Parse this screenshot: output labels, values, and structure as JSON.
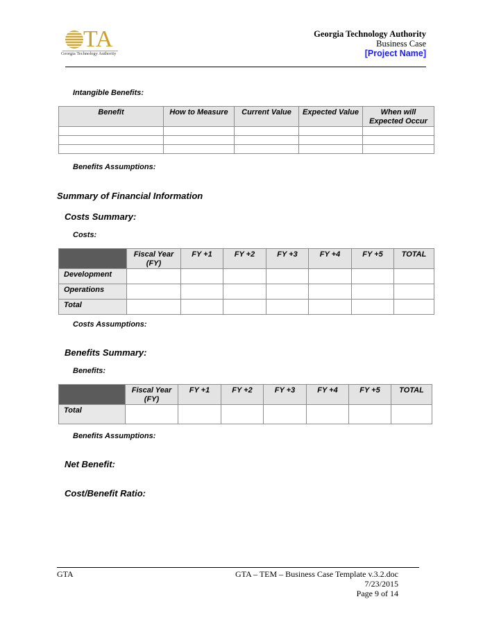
{
  "header": {
    "logo_text": "GTA",
    "logo_subtitle": "Georgia Technology Authority",
    "organization": "Georgia Technology Authority",
    "document_type": "Business Case",
    "project_name": "[Project Name]"
  },
  "intangible_benefits": {
    "label": "Intangible Benefits:",
    "columns": [
      "Benefit",
      "How to Measure",
      "Current Value",
      "Expected Value",
      "When will Expected Occur"
    ],
    "rows": [
      [
        "",
        "",
        "",
        "",
        ""
      ],
      [
        "",
        "",
        "",
        "",
        ""
      ],
      [
        "",
        "",
        "",
        "",
        ""
      ]
    ]
  },
  "benefits_assumptions_1": "Benefits Assumptions:",
  "summary_heading": "Summary of Financial Information",
  "costs_summary": {
    "heading": "Costs Summary:",
    "label": "Costs:",
    "columns": [
      "",
      "Fiscal Year (FY)",
      "FY +1",
      "FY +2",
      "FY +3",
      "FY +4",
      "FY +5",
      "TOTAL"
    ],
    "rows": [
      {
        "label": "Development",
        "values": [
          "",
          "",
          "",
          "",
          "",
          "",
          ""
        ]
      },
      {
        "label": "Operations",
        "values": [
          "",
          "",
          "",
          "",
          "",
          "",
          ""
        ]
      },
      {
        "label": "Total",
        "values": [
          "",
          "",
          "",
          "",
          "",
          "",
          ""
        ]
      }
    ],
    "assumptions": "Costs Assumptions:"
  },
  "benefits_summary": {
    "heading": "Benefits Summary:",
    "label": "Benefits:",
    "columns": [
      "",
      "Fiscal Year (FY)",
      "FY +1",
      "FY +2",
      "FY +3",
      "FY +4",
      "FY +5",
      "TOTAL"
    ],
    "rows": [
      {
        "label": "Total",
        "values": [
          "",
          "",
          "",
          "",
          "",
          "",
          ""
        ]
      }
    ],
    "assumptions": "Benefits Assumptions:"
  },
  "net_benefit": "Net Benefit:",
  "cost_benefit_ratio": "Cost/Benefit Ratio:",
  "footer": {
    "left": "GTA",
    "document_name": "GTA – TEM – Business Case Template v.3.2.doc",
    "date": "7/23/2015",
    "page": "Page 9 of 14"
  },
  "colors": {
    "logo_gold": "#c8a22e",
    "project_name_blue": "#1a1aff",
    "table_header_gray": "#e3e3e3",
    "table_corner_dark": "#5b5b5b"
  }
}
